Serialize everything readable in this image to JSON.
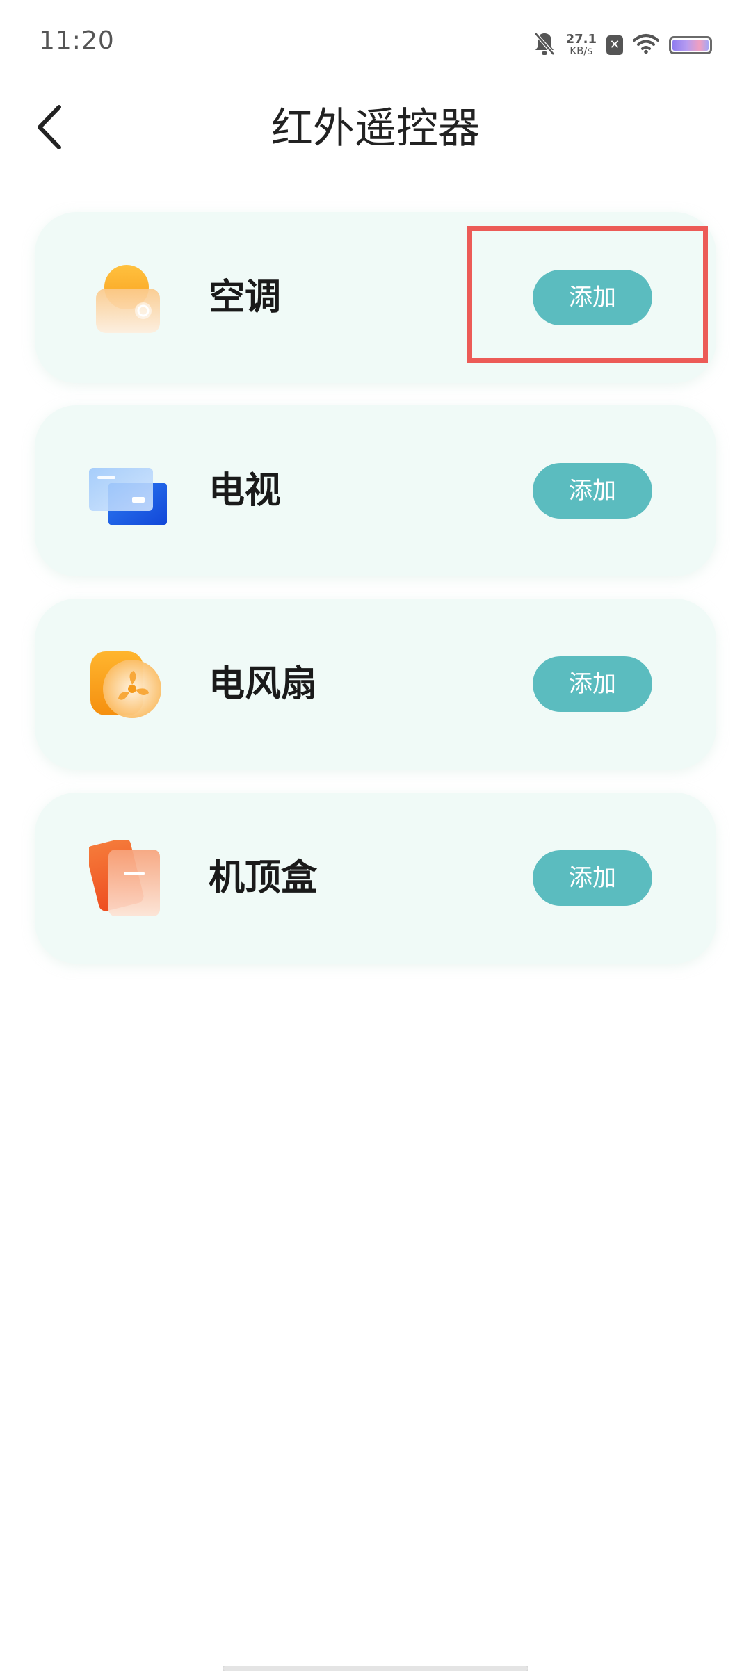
{
  "status_bar": {
    "time": "11:20",
    "net_speed_value": "27.1",
    "net_speed_unit": "KB/s",
    "sim_badge": "✕",
    "icons": [
      "bell-off-icon",
      "sim-x-icon",
      "wifi-icon",
      "battery-icon"
    ]
  },
  "header": {
    "title": "红外遥控器",
    "back_icon": "chevron-left-icon"
  },
  "devices": [
    {
      "name": "空调",
      "icon": "air-conditioner-icon",
      "action": "添加"
    },
    {
      "name": "电视",
      "icon": "tv-icon",
      "action": "添加"
    },
    {
      "name": "电风扇",
      "icon": "fan-icon",
      "action": "添加"
    },
    {
      "name": "机顶盒",
      "icon": "set-top-box-icon",
      "action": "添加"
    }
  ],
  "colors": {
    "accent": "#5bbcbf",
    "card_background": "#f0faf7",
    "highlight": "#ec5b57",
    "title_text": "#222222"
  }
}
